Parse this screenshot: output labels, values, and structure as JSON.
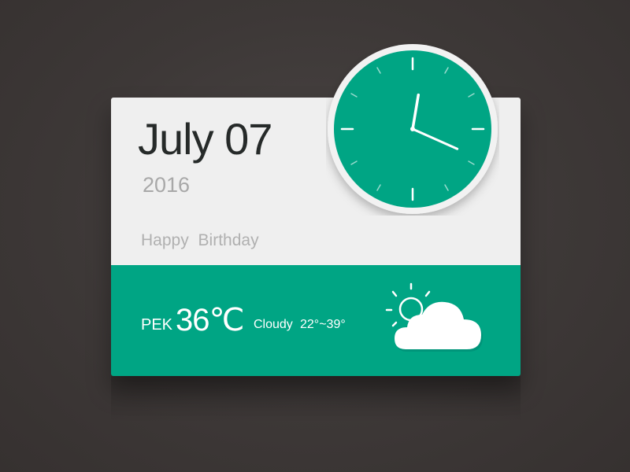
{
  "widget": {
    "date": {
      "month_day": "July 07",
      "year": "2016"
    },
    "greeting": "Happy  Birthday",
    "clock": {
      "hour": 12,
      "minute": 19,
      "face_color": "#00a584",
      "hand_color": "#ffffff"
    },
    "weather": {
      "city": "PEK",
      "temperature": "36℃",
      "condition": "Cloudy",
      "range": "22°~39°",
      "icon": "partly-cloudy-icon"
    },
    "colors": {
      "accent": "#00a584",
      "panel": "#efefef",
      "background": "#3d3837",
      "date_text": "#262a29",
      "muted_text": "#a8a8a8"
    }
  }
}
